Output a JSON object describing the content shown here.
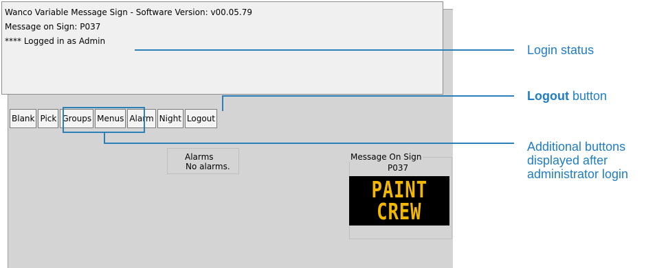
{
  "status": {
    "title_line": "Wanco Variable Message Sign - Software Version: v00.05.79",
    "message_line": "Message on Sign: P037",
    "login_line": "**** Logged in as Admin"
  },
  "toolbar": {
    "buttons": [
      "Blank",
      "Pick",
      "Groups",
      "Menus",
      "Alarm",
      "Night",
      "Logout"
    ]
  },
  "alarms": {
    "label": "Alarms",
    "text": "No alarms."
  },
  "sign": {
    "label": "Message On Sign",
    "code": "P037",
    "lines": [
      "PAINT",
      "CREW"
    ],
    "text_color": "#f2b800",
    "background": "#000000"
  },
  "callouts": {
    "login_status": "Login status",
    "logout_bold": "Logout",
    "logout_rest": " button",
    "additional_lines": [
      "Additional buttons",
      "displayed after",
      "administrator login"
    ],
    "color": "#1f7dc3"
  }
}
